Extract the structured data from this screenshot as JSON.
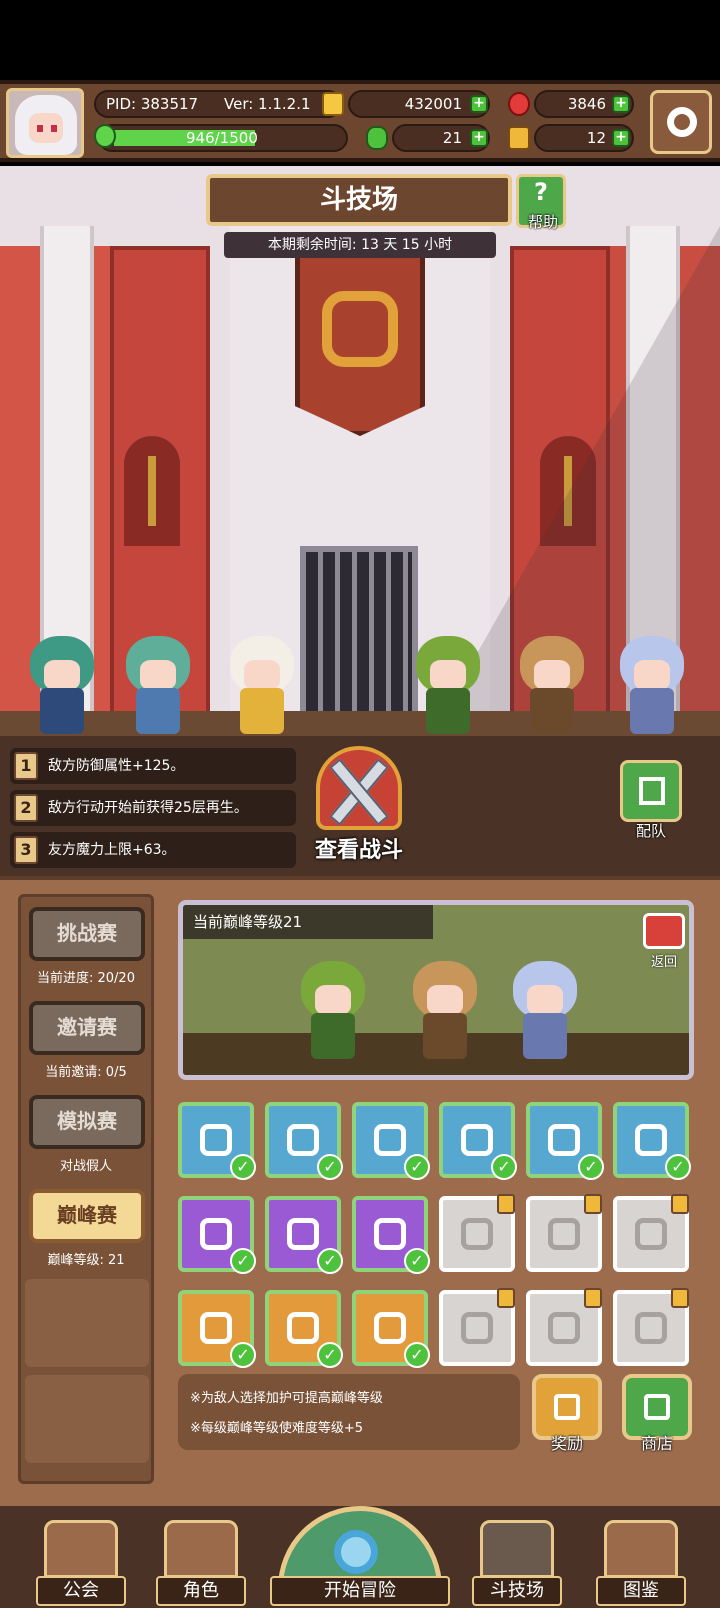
{
  "topbar": {
    "pid": "PID: 383517",
    "version": "Ver: 1.1.2.1",
    "gold": "432001",
    "gems": "3846",
    "energy": "946/1500",
    "energy_fraction": 0.63,
    "clover": "21",
    "keys": "12",
    "colors": {
      "gold": "#f5c842",
      "gem": "#e33a3a",
      "clover": "#4ec23c",
      "key": "#f0b83a"
    }
  },
  "arena": {
    "title": "斗技场",
    "help_label": "帮助",
    "timer": "本期剩余时间: 13 天 15 小时"
  },
  "buffs": [
    {
      "num": "1",
      "text": "敌方防御属性+125。"
    },
    {
      "num": "2",
      "text": "敌方行动开始前获得25层再生。"
    },
    {
      "num": "3",
      "text": "友方魔力上限+63。"
    }
  ],
  "fight_label": "查看战斗",
  "team_label": "配队",
  "modes": [
    {
      "label": "挑战赛",
      "sub": "当前进度: 20/20",
      "active": false
    },
    {
      "label": "邀请赛",
      "sub": "当前邀请: 0/5",
      "active": false
    },
    {
      "label": "模拟赛",
      "sub": "对战假人",
      "active": false
    },
    {
      "label": "巅峰赛",
      "sub": "巅峰等级: 21",
      "active": true
    }
  ],
  "preview": {
    "level_text": "当前巅峰等级21",
    "back_label": "返回"
  },
  "modifiers": [
    {
      "icon": "cloud-icon",
      "color": "blue",
      "checked": true
    },
    {
      "icon": "sun-icon",
      "color": "blue",
      "checked": true
    },
    {
      "icon": "sparkle-icon",
      "color": "blue",
      "checked": true
    },
    {
      "icon": "tornado-icon",
      "color": "blue",
      "checked": true
    },
    {
      "icon": "feather-icon",
      "color": "blue",
      "checked": true
    },
    {
      "icon": "paw-icon",
      "color": "blue",
      "checked": true
    },
    {
      "icon": "sleep-icon",
      "color": "purple",
      "checked": true
    },
    {
      "icon": "skull-icon",
      "color": "purple",
      "checked": true
    },
    {
      "icon": "tombstone-icon",
      "color": "purple",
      "checked": true
    },
    {
      "icon": "mushroom-cloud-icon",
      "color": "grey",
      "locked": true
    },
    {
      "icon": "snowflake-icon",
      "color": "grey",
      "locked": true
    },
    {
      "icon": "wind-icon",
      "color": "grey",
      "locked": true
    },
    {
      "icon": "fist-icon",
      "color": "orange",
      "checked": true
    },
    {
      "icon": "shield-cross-icon",
      "color": "orange",
      "checked": true
    },
    {
      "icon": "claw-icon",
      "color": "orange",
      "checked": true
    },
    {
      "icon": "shield-icon",
      "color": "grey",
      "locked": true
    },
    {
      "icon": "rings-icon",
      "color": "grey",
      "locked": true
    },
    {
      "icon": "infinity-icon",
      "color": "grey",
      "locked": true
    }
  ],
  "notes": [
    "※为敌人选择加护可提高巅峰等级",
    "※每级巅峰等级使难度等级+5"
  ],
  "reward_label": "奖励",
  "shop_label": "商店",
  "nav": {
    "guild": "公会",
    "character": "角色",
    "adventure": "开始冒险",
    "arena": "斗技场",
    "codex": "图鉴"
  }
}
